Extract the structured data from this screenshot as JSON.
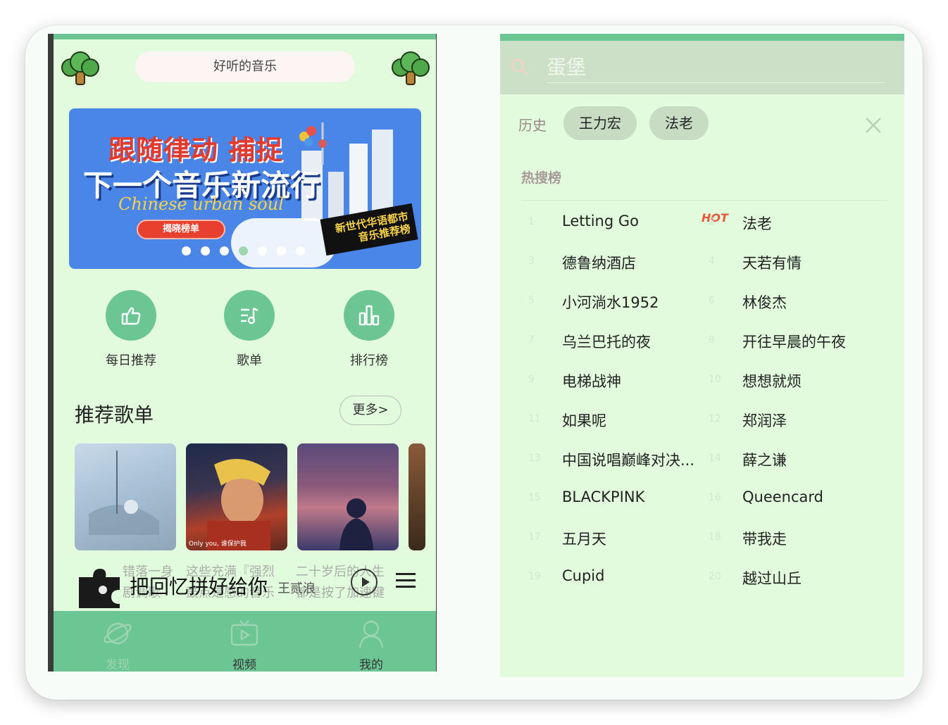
{
  "left": {
    "search": {
      "label": "好听的音乐"
    },
    "banner": {
      "line1": "跟随律动 捕捉",
      "line2": "下一个音乐新流行",
      "line3": "Chinese urban soul",
      "button": "揭晓榜单",
      "tag": "新世代华语都市音乐推荐榜",
      "dots": 7,
      "active_dot": 3
    },
    "quick": [
      {
        "label": "每日推荐",
        "icon": "thumbs-up-icon"
      },
      {
        "label": "歌单",
        "icon": "playlist-icon"
      },
      {
        "label": "排行榜",
        "icon": "bar-chart-icon"
      }
    ],
    "recommend": {
      "title": "推荐歌单",
      "more": "更多>",
      "covers": [
        {
          "overlay": ""
        },
        {
          "overlay": "Only you, 谁保护我"
        },
        {
          "overlay": ""
        }
      ],
      "ghost_row1": [
        "错落一身",
        "这些充满『强烈",
        "二十岁后的人生"
      ],
      "ghost_row2": [
        "剧调歌",
        "鼓点是感的音乐",
        "都是按了加速键"
      ]
    },
    "player": {
      "title": "把回忆拼好给你",
      "artist": "王贰浪"
    },
    "tabs": [
      {
        "label": "发现",
        "icon": "discover-planet-icon"
      },
      {
        "label": "视频",
        "icon": "video-tv-icon"
      },
      {
        "label": "我的",
        "icon": "user-icon"
      }
    ]
  },
  "right": {
    "search": {
      "placeholder": "蛋堡"
    },
    "history": {
      "label": "历史",
      "items": [
        "王力宏",
        "法老"
      ]
    },
    "hot": {
      "title": "热搜榜",
      "badge": "HOT",
      "items": [
        {
          "rank": "1",
          "name": "Letting Go"
        },
        {
          "rank": "2",
          "name": "法老"
        },
        {
          "rank": "3",
          "name": "德鲁纳酒店"
        },
        {
          "rank": "4",
          "name": "天若有情"
        },
        {
          "rank": "5",
          "name": "小河淌水1952"
        },
        {
          "rank": "6",
          "name": "林俊杰"
        },
        {
          "rank": "7",
          "name": "乌兰巴托的夜"
        },
        {
          "rank": "8",
          "name": "开往早晨的午夜"
        },
        {
          "rank": "9",
          "name": "电梯战神"
        },
        {
          "rank": "10",
          "name": "想想就烦"
        },
        {
          "rank": "11",
          "name": "如果呢"
        },
        {
          "rank": "12",
          "name": "郑润泽"
        },
        {
          "rank": "13",
          "name": "中国说唱巅峰对决..."
        },
        {
          "rank": "14",
          "name": "薛之谦"
        },
        {
          "rank": "15",
          "name": "BLACKPINK"
        },
        {
          "rank": "16",
          "name": "Queencard"
        },
        {
          "rank": "17",
          "name": "五月天"
        },
        {
          "rank": "18",
          "name": "带我走"
        },
        {
          "rank": "19",
          "name": "Cupid"
        },
        {
          "rank": "20",
          "name": "越过山丘"
        }
      ]
    }
  },
  "colors": {
    "accent": "#6cc694",
    "bg": "#e1fbdc",
    "hot": "#e55a3c"
  }
}
